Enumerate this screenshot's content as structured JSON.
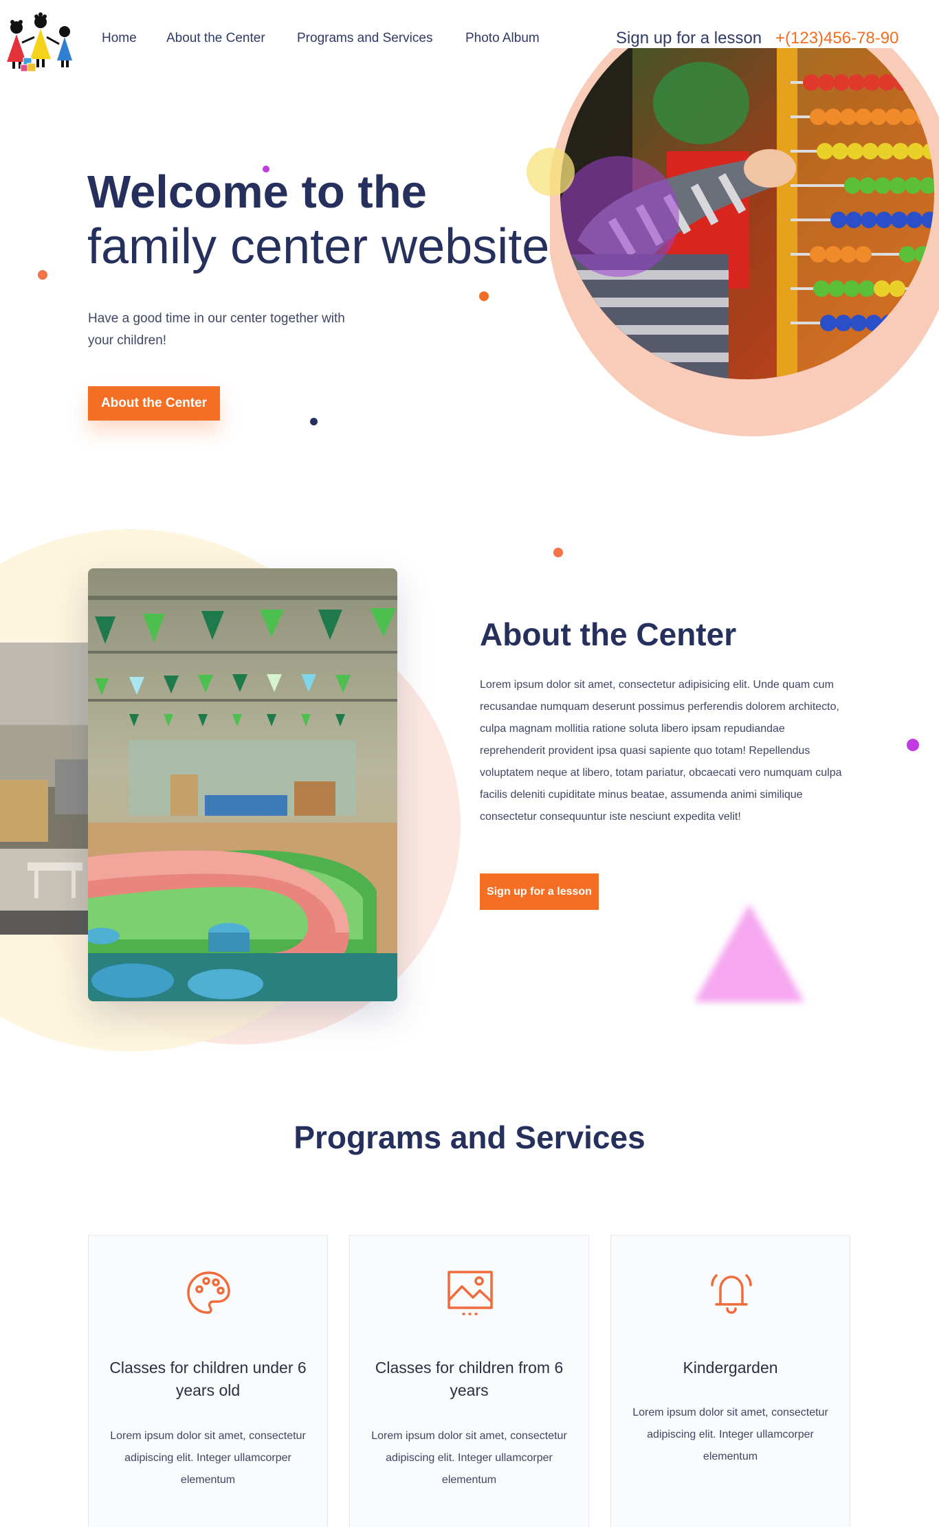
{
  "nav": {
    "links": [
      "Home",
      "About the Center",
      "Programs and Services",
      "Photo Album"
    ],
    "signup": "Sign up for a lesson",
    "phone": "+(123)456-78-90"
  },
  "hero": {
    "title_bold": "Welcome to the",
    "title_light": "family center website",
    "subtitle": "Have a good time in our center together with your children!",
    "button": "About the Center"
  },
  "about": {
    "title": "About the Center",
    "text": "Lorem ipsum dolor sit amet, consectetur adipisicing elit. Unde quam cum recusandae numquam deserunt possimus perferendis dolorem architecto, culpa magnam mollitia ratione soluta libero ipsam repudiandae reprehenderit provident ipsa quasi sapiente quo totam! Repellendus voluptatem neque at libero, totam pariatur, obcaecati vero numquam culpa facilis deleniti cupiditate minus beatae, assumenda animi similique consectetur consequuntur iste nesciunt expedita velit!",
    "button": "Sign up for a lesson"
  },
  "programs": {
    "title": "Programs and Services",
    "cards": [
      {
        "icon": "palette-icon",
        "title": "Classes for children under 6 years old",
        "text": "Lorem ipsum dolor sit amet, consectetur adipiscing elit. Integer ullamcorper elementum"
      },
      {
        "icon": "image-icon",
        "title": "Classes for children from 6 years",
        "text": "Lorem ipsum dolor sit amet, consectetur adipiscing elit. Integer ullamcorper elementum"
      },
      {
        "icon": "bell-icon",
        "title": "Kindergarden",
        "text": "Lorem ipsum dolor sit amet, consectetur adipiscing elit. Integer ullamcorper elementum"
      }
    ]
  },
  "colors": {
    "accent": "#f46f24",
    "navy": "#26305d",
    "peach": "#f9cbb9",
    "cream": "#fdf3d7",
    "purple_dot": "#c03be0"
  }
}
